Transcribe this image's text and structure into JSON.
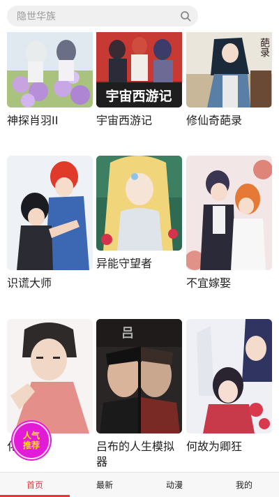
{
  "search": {
    "placeholder": "隐世华族"
  },
  "comics": [
    {
      "title": "神探肖羽II"
    },
    {
      "title": "宇宙西游记",
      "cover_text": "宇宙西游记"
    },
    {
      "title": "修仙奇葩录",
      "cover_text": "葩录"
    },
    {
      "title": "识谎大师"
    },
    {
      "title": "异能守望者"
    },
    {
      "title": "不宜嫁娶"
    },
    {
      "title": "化"
    },
    {
      "title": "吕布的人生模拟器"
    },
    {
      "title": "何故为卿狂"
    }
  ],
  "badge": {
    "line1": "人气",
    "line2": "推荐"
  },
  "tabs": [
    {
      "label": "首页",
      "active": true
    },
    {
      "label": "最新"
    },
    {
      "label": "动漫"
    },
    {
      "label": "我的"
    }
  ],
  "colors": {
    "accent": "#e5373f",
    "badge": "#e11bd6"
  }
}
